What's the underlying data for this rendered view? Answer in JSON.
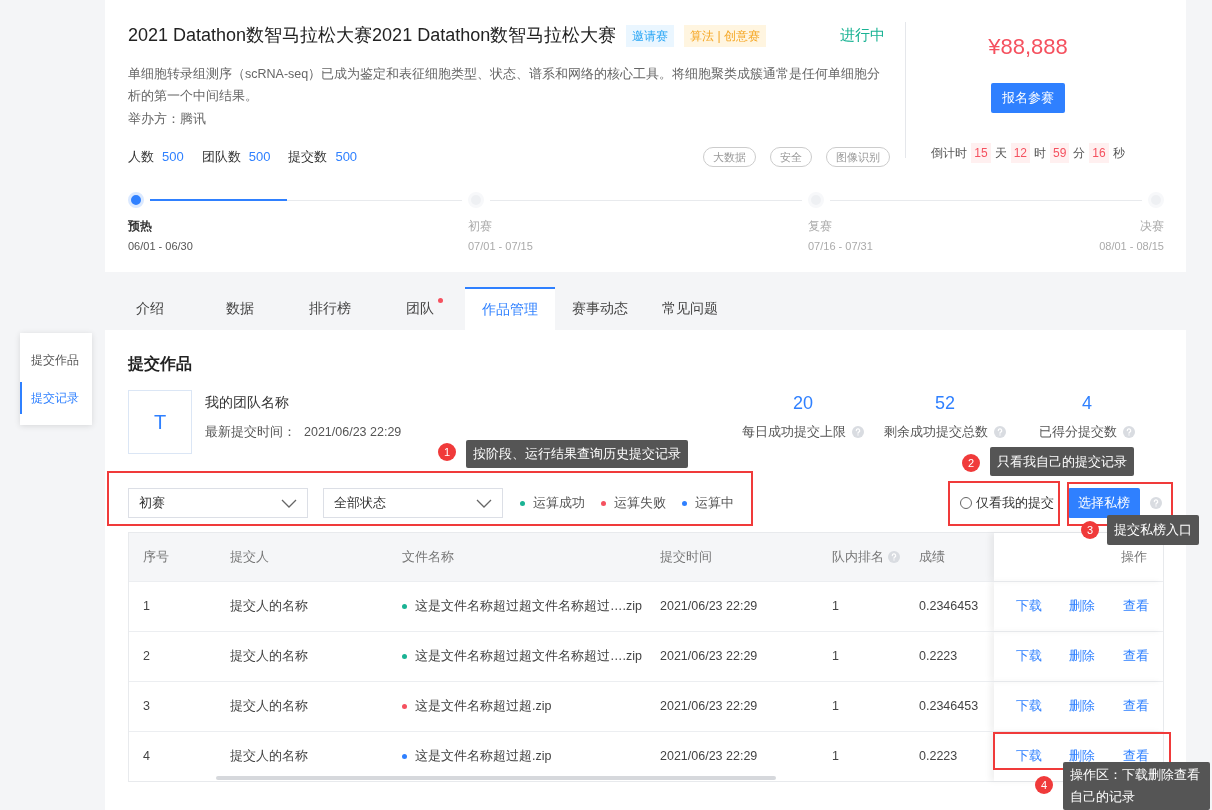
{
  "header": {
    "title": "2021 Datathon数智马拉松大赛2021 Datathon数智马拉松大赛",
    "badges": [
      {
        "text": "邀请赛",
        "kind": "invite"
      },
      {
        "text": "算法 | 创意赛",
        "kind": "category"
      }
    ],
    "status": "进行中",
    "description": "单细胞转录组测序（scRNA-seq）已成为鉴定和表征细胞类型、状态、谱系和网络的核心工具。将细胞聚类成簇通常是任何单细胞分析的第一个中间结果。",
    "organizer": "举办方：腾讯",
    "counts": [
      {
        "label": "人数",
        "value": "500"
      },
      {
        "label": "团队数",
        "value": "500"
      },
      {
        "label": "提交数",
        "value": "500"
      }
    ],
    "tags": [
      "大数据",
      "安全",
      "图像识别"
    ],
    "prize": "¥88,888",
    "register_button": "报名参赛",
    "countdown": {
      "label": "倒计时",
      "parts": [
        {
          "value": "15",
          "unit": "天"
        },
        {
          "value": "12",
          "unit": "时"
        },
        {
          "value": "59",
          "unit": "分"
        },
        {
          "value": "16",
          "unit": "秒"
        }
      ]
    }
  },
  "stages": [
    {
      "name": "预热",
      "dates": "06/01 - 06/30",
      "selected": true
    },
    {
      "name": "初赛",
      "dates": "07/01 - 07/15",
      "selected": false
    },
    {
      "name": "复赛",
      "dates": "07/16 - 07/31",
      "selected": false
    },
    {
      "name": "决赛",
      "dates": "08/01 - 08/15",
      "selected": false
    }
  ],
  "stage_progress": {
    "level": 0.44
  },
  "tabs": [
    {
      "label": "介绍",
      "selected": false,
      "dot": false
    },
    {
      "label": "数据",
      "selected": false,
      "dot": false
    },
    {
      "label": "排行榜",
      "selected": false,
      "dot": false
    },
    {
      "label": "团队",
      "selected": false,
      "dot": true
    },
    {
      "label": "作品管理",
      "selected": true,
      "dot": false
    },
    {
      "label": "赛事动态",
      "selected": false,
      "dot": false
    },
    {
      "label": "常见问题",
      "selected": false,
      "dot": false
    }
  ],
  "side_nav": [
    {
      "label": "提交作品",
      "selected": false
    },
    {
      "label": "提交记录",
      "selected": true
    }
  ],
  "submission": {
    "title": "提交作品",
    "team": {
      "avatar": "T",
      "name": "我的团队名称",
      "latest_label": "最新提交时间：",
      "latest_time": "2021/06/23 22:29"
    },
    "stats": [
      {
        "value": "20",
        "label": "每日成功提交上限"
      },
      {
        "value": "52",
        "label": "剩余成功提交总数"
      },
      {
        "value": "4",
        "label": "已得分提交数"
      }
    ]
  },
  "filters": {
    "selects": [
      {
        "value": "初赛"
      },
      {
        "value": "全部状态"
      }
    ],
    "legend": [
      {
        "label": "运算成功",
        "color": "#1ab394"
      },
      {
        "label": "运算失败",
        "color": "#f5515f"
      },
      {
        "label": "运算中",
        "color": "#2f80ff"
      }
    ],
    "only_mine": {
      "label": "仅看我的提交",
      "checked": false
    },
    "private_button": "选择私榜"
  },
  "table": {
    "columns": [
      {
        "label": "序号",
        "kind": "plain"
      },
      {
        "label": "提交人",
        "kind": "plain"
      },
      {
        "label": "文件名称",
        "kind": "plain"
      },
      {
        "label": "提交时间",
        "kind": "plain"
      },
      {
        "label": "队内排名",
        "kind": "with_help"
      },
      {
        "label": "成绩",
        "kind": "plain"
      },
      {
        "label": "操作",
        "kind": "plain"
      }
    ],
    "rows": [
      {
        "index": "1",
        "submitter": "提交人的名称",
        "file": "这是文件名称超过超文件名称超过….zip",
        "color": "#1ab394",
        "time": "2021/06/23 22:29",
        "rank": "1",
        "score": "0.2346453",
        "actions": [
          "下载",
          "删除",
          "查看"
        ]
      },
      {
        "index": "2",
        "submitter": "提交人的名称",
        "file": "这是文件名称超过超文件名称超过….zip",
        "color": "#1ab394",
        "time": "2021/06/23 22:29",
        "rank": "1",
        "score": "0.2223",
        "actions": [
          "下载",
          "删除",
          "查看"
        ]
      },
      {
        "index": "3",
        "submitter": "提交人的名称",
        "file": "这是文件名称超过超.zip",
        "color": "#f5515f",
        "time": "2021/06/23 22:29",
        "rank": "1",
        "score": "0.2346453",
        "actions": [
          "下载",
          "删除",
          "查看"
        ]
      },
      {
        "index": "4",
        "submitter": "提交人的名称",
        "file": "这是文件名称超过超.zip",
        "color": "#2f80ff",
        "time": "2021/06/23 22:29",
        "rank": "1",
        "score": "0.2223",
        "actions": [
          "下载",
          "删除",
          "查看"
        ]
      }
    ]
  },
  "annotations": [
    {
      "number": "1",
      "text": "按阶段、运行结果查询历史提交记录"
    },
    {
      "number": "2",
      "text": "只看我自己的提交记录"
    },
    {
      "number": "3",
      "text": "提交私榜入口"
    },
    {
      "number": "4",
      "text": "操作区：下载删除查看自己的记录"
    }
  ]
}
